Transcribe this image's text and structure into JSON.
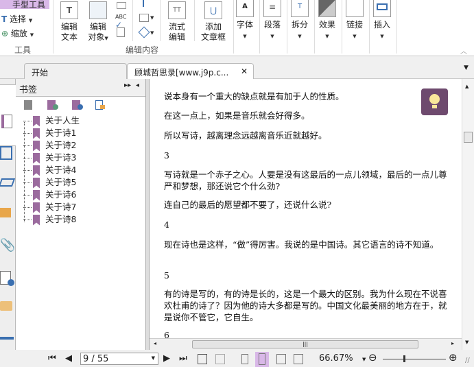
{
  "ribbon": {
    "tools_group": {
      "hand_tool": "手型工具",
      "select": "选择",
      "zoom": "缩放",
      "label": "工具"
    },
    "edit_group": {
      "edit_text": [
        "编辑",
        "文本"
      ],
      "edit_object": [
        "编辑",
        "对象"
      ],
      "flow_edit": [
        "流式",
        "编辑"
      ],
      "add_article": [
        "添加",
        "文章框"
      ],
      "label": "编辑内容"
    },
    "buttons": [
      {
        "label": "字体"
      },
      {
        "label": "段落"
      },
      {
        "label": "拆分"
      },
      {
        "label": "效果"
      },
      {
        "label": "链接"
      },
      {
        "label": "插入"
      }
    ]
  },
  "tabs": [
    {
      "label": "开始",
      "active": false
    },
    {
      "label": "顾城哲思录[www.j9p.c...",
      "active": true
    }
  ],
  "bookmarks": {
    "title": "书签",
    "items": [
      "关于人生",
      "关于诗1",
      "关于诗2",
      "关于诗3",
      "关于诗4",
      "关于诗5",
      "关于诗6",
      "关于诗7",
      "关于诗8"
    ]
  },
  "document": {
    "paragraphs": [
      "说本身有一个重大的缺点就是有加于人的性质。",
      "在这一点上，如果是音乐就会好得多。",
      "所以写诗，越离理念远越离音乐近就越好。",
      "3",
      "写诗就是一个赤子之心。人要是没有这最后的一点儿领域，最后的一点儿尊严和梦想，那还说它个什么劲?",
      "连自己的最后的愿望都不要了，还说什么说?",
      "4",
      "现在诗也是这样，“做”得厉害。我说的是中国诗。其它语言的诗不知道。",
      "5",
      "有的诗是写的，有的诗是长的，这是一个最大的区别。我为什么现在不说喜欢杜甫的诗了？因为他的诗大多都是写的。中国文化最美丽的地方在于，就是说你不管它，它自生。",
      "6"
    ]
  },
  "status": {
    "page": "9 / 55",
    "zoom": "66.67%",
    "zoom_slider_fraction": 0.35
  },
  "colors": {
    "accent": "#9b6b9e",
    "hint_bg": "#6e4a6e",
    "highlight": "#d9b8e8"
  }
}
